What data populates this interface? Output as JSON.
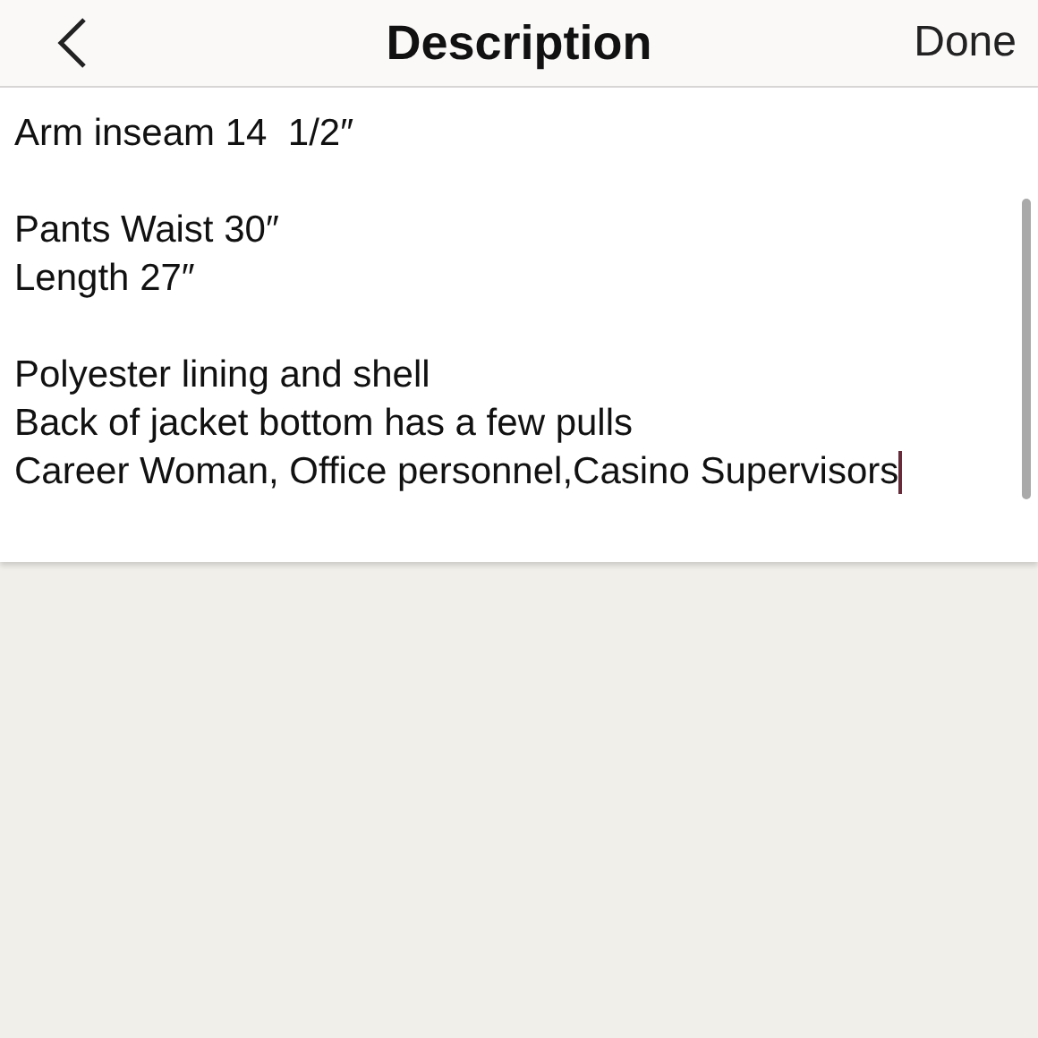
{
  "nav_bar": {
    "title": "Description",
    "done": "Done"
  },
  "description": {
    "paragraphs": [
      [
        "Arm inseam 14  1/2″"
      ],
      [
        "Pants Waist 30″",
        "Length 27″"
      ],
      [
        "Polyester lining and shell",
        "Back of jacket bottom has a few pulls",
        "Career Woman, Office personnel,Casino Supervisors"
      ]
    ]
  }
}
